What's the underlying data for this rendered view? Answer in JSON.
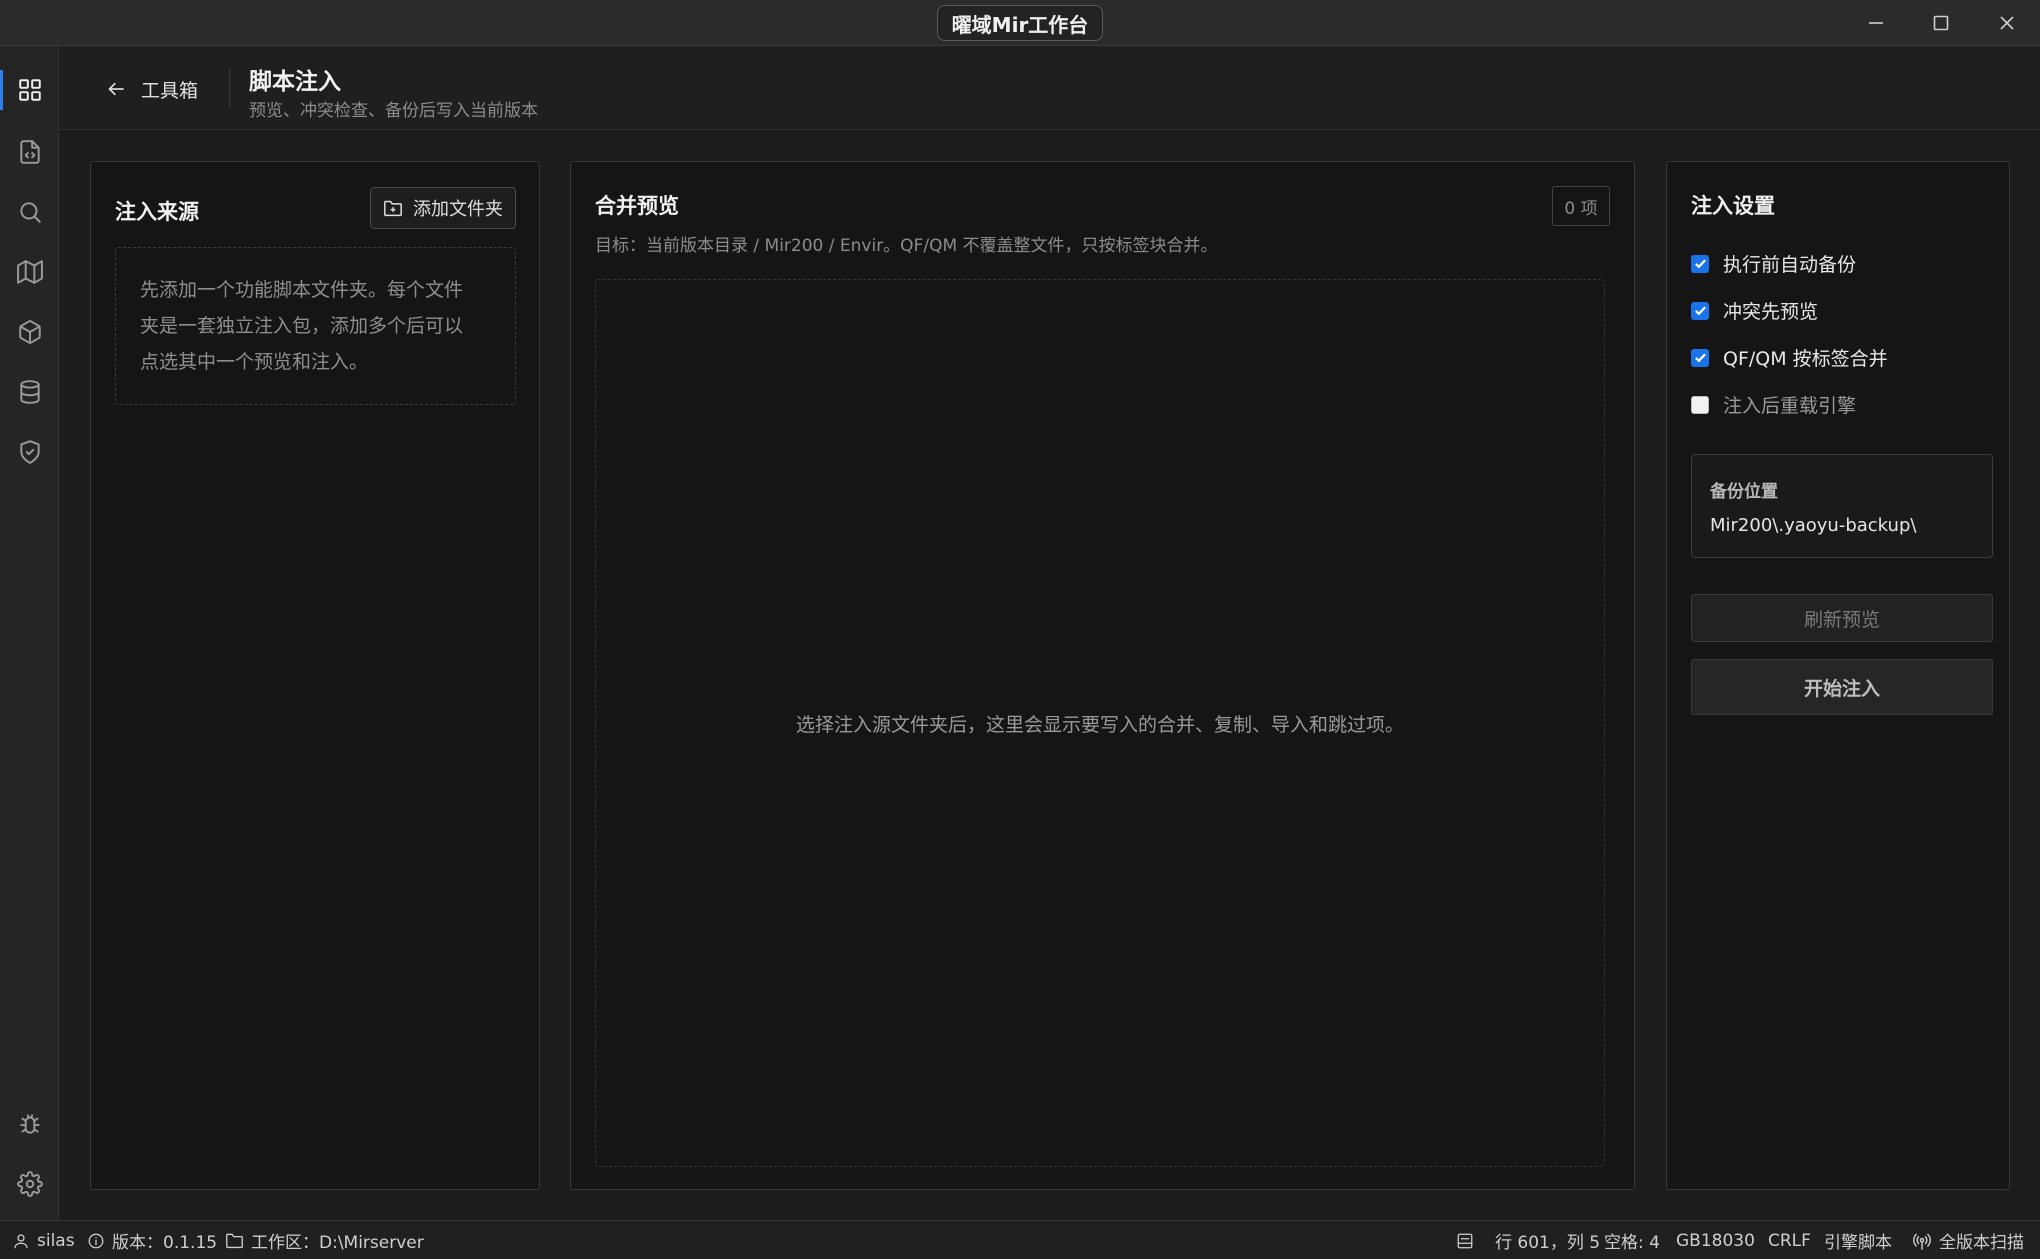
{
  "app": {
    "title": "曜域Mir工作台"
  },
  "activity_bar": {
    "items": [
      {
        "icon": "grid-icon",
        "active": true
      },
      {
        "icon": "file-code-icon",
        "active": false
      },
      {
        "icon": "search-icon",
        "active": false
      },
      {
        "icon": "map-icon",
        "active": false
      },
      {
        "icon": "package-icon",
        "active": false
      },
      {
        "icon": "database-icon",
        "active": false
      },
      {
        "icon": "shield-check-icon",
        "active": false
      }
    ],
    "bottom_items": [
      {
        "icon": "bug-icon"
      },
      {
        "icon": "gear-icon"
      }
    ]
  },
  "header": {
    "back_label": "工具箱",
    "title": "脚本注入",
    "subtitle": "预览、冲突检查、备份后写入当前版本"
  },
  "source_panel": {
    "title": "注入来源",
    "add_folder_label": "添加文件夹",
    "hint_lines": [
      "先添加一个功能脚本文件夹。每个文件",
      "夹是一套独立注入包，添加多个后可以",
      "点选其中一个预览和注入。"
    ]
  },
  "preview_panel": {
    "title": "合并预览",
    "count_label": "0 项",
    "target_text": "目标：当前版本目录 / Mir200 / Envir。QF/QM 不覆盖整文件，只按标签块合并。",
    "empty_text": "选择注入源文件夹后，这里会显示要写入的合并、复制、导入和跳过项。"
  },
  "settings_panel": {
    "title": "注入设置",
    "options": [
      {
        "label": "执行前自动备份",
        "checked": true
      },
      {
        "label": "冲突先预览",
        "checked": true
      },
      {
        "label": "QF/QM 按标签合并",
        "checked": true
      },
      {
        "label": "注入后重载引擎",
        "checked": false
      }
    ],
    "backup_label": "备份位置",
    "backup_path": "Mir200\\.yaoyu-backup\\",
    "refresh_label": "刷新预览",
    "start_label": "开始注入"
  },
  "statusbar": {
    "user": "silas",
    "version": "版本：0.1.15",
    "workspace": "工作区：D:\\Mirserver",
    "cursor": "行 601，列 5",
    "indent": "空格: 4",
    "encoding": "GB18030",
    "eol": "CRLF",
    "language": "引擎脚本",
    "scan": "全版本扫描"
  },
  "colors": {
    "accent": "#1a73e8",
    "background": "#1c1c1c",
    "panel": "#151515"
  }
}
